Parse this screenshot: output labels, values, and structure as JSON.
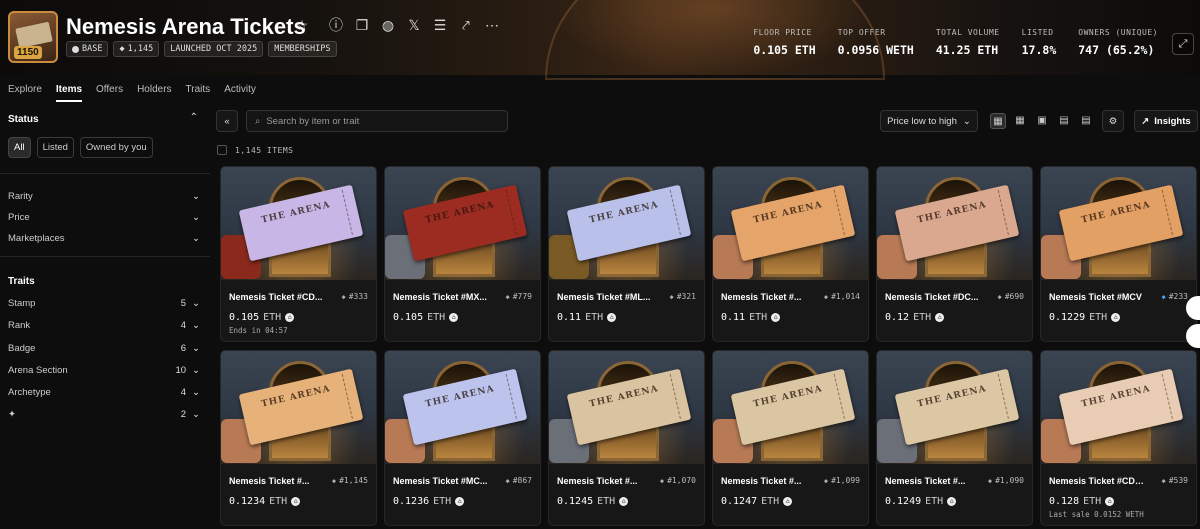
{
  "collection": {
    "title": "Nemesis Arena Tickets",
    "logo_badge": "1150",
    "chips": [
      "BASE",
      "1,145",
      "LAUNCHED OCT 2025",
      "MEMBERSHIPS"
    ],
    "header_icons": [
      "star-icon",
      "info-icon",
      "copy-icon",
      "globe-icon",
      "x-icon",
      "layers-icon",
      "share-icon",
      "more-icon"
    ]
  },
  "stats": [
    {
      "label": "FLOOR PRICE",
      "value": "0.105 ETH"
    },
    {
      "label": "TOP OFFER",
      "value": "0.0956 WETH"
    },
    {
      "label": "TOTAL VOLUME",
      "value": "41.25 ETH"
    },
    {
      "label": "LISTED",
      "value": "17.8%"
    },
    {
      "label": "OWNERS (UNIQUE)",
      "value": "747 (65.2%)"
    }
  ],
  "tabs": [
    "Explore",
    "Items",
    "Offers",
    "Holders",
    "Traits",
    "Activity"
  ],
  "sidebar": {
    "status_title": "Status",
    "status_options": [
      "All",
      "Listed",
      "Owned by you"
    ],
    "filters": [
      "Rarity",
      "Price",
      "Marketplaces"
    ],
    "traits_title": "Traits",
    "traits": [
      {
        "name": "Stamp",
        "count": "5"
      },
      {
        "name": "Rank",
        "count": "4"
      },
      {
        "name": "Badge",
        "count": "6"
      },
      {
        "name": "Arena Section",
        "count": "10"
      },
      {
        "name": "Archetype",
        "count": "4"
      },
      {
        "name": "✦",
        "count": "2"
      }
    ]
  },
  "toolbar": {
    "search_placeholder": "Search by item or trait",
    "sort": "Price low to high",
    "insights": "Insights",
    "item_count": "1,145 ITEMS"
  },
  "items": [
    {
      "name": "Nemesis Ticket #CD...",
      "rank": "#333",
      "price": "0.105",
      "unit": "ETH",
      "sub": "Ends in 04:57",
      "color": "#c7b6e6",
      "hand": "#8b2a1c",
      "rank_color": "gray"
    },
    {
      "name": "Nemesis Ticket #MX...",
      "rank": "#779",
      "price": "0.105",
      "unit": "ETH",
      "sub": "",
      "color": "#9c2b22",
      "hand": "#6b6f78",
      "rank_color": "gray"
    },
    {
      "name": "Nemesis Ticket #ML...",
      "rank": "#321",
      "price": "0.11",
      "unit": "ETH",
      "sub": "",
      "color": "#b9c0ea",
      "hand": "#7a5a24",
      "rank_color": "gray"
    },
    {
      "name": "Nemesis Ticket #...",
      "rank": "#1,014",
      "price": "0.11",
      "unit": "ETH",
      "sub": "",
      "color": "#e4a46a",
      "hand": "#b77a55",
      "rank_color": "gray"
    },
    {
      "name": "Nemesis Ticket #DC...",
      "rank": "#690",
      "price": "0.12",
      "unit": "ETH",
      "sub": "",
      "color": "#d9a88f",
      "hand": "#b77a55",
      "rank_color": "gray"
    },
    {
      "name": "Nemesis Ticket #MCV",
      "rank": "#233",
      "price": "0.1229",
      "unit": "ETH",
      "sub": "",
      "color": "#e3a064",
      "hand": "#b77a55",
      "rank_color": "blue"
    },
    {
      "name": "Nemesis Ticket #...",
      "rank": "#1,145",
      "price": "0.1234",
      "unit": "ETH",
      "sub": "",
      "color": "#e7b27a",
      "hand": "#b77a55",
      "rank_color": "gray"
    },
    {
      "name": "Nemesis Ticket #MC...",
      "rank": "#867",
      "price": "0.1236",
      "unit": "ETH",
      "sub": "",
      "color": "#bcc4ee",
      "hand": "#b77a55",
      "rank_color": "gray"
    },
    {
      "name": "Nemesis Ticket #...",
      "rank": "#1,070",
      "price": "0.1245",
      "unit": "ETH",
      "sub": "",
      "color": "#d9c3a0",
      "hand": "#6b6f78",
      "rank_color": "gray"
    },
    {
      "name": "Nemesis Ticket #...",
      "rank": "#1,099",
      "price": "0.1247",
      "unit": "ETH",
      "sub": "",
      "color": "#dbc6a4",
      "hand": "#b77a55",
      "rank_color": "gray"
    },
    {
      "name": "Nemesis Ticket #...",
      "rank": "#1,090",
      "price": "0.1249",
      "unit": "ETH",
      "sub": "",
      "color": "#dcc7a5",
      "hand": "#6b6f78",
      "rank_color": "gray"
    },
    {
      "name": "Nemesis Ticket #CDLII",
      "rank": "#539",
      "price": "0.128",
      "unit": "ETH",
      "sub": "Last sale 0.0152 WETH",
      "color": "#e8cdb4",
      "hand": "#b77a55",
      "rank_color": "gray"
    }
  ]
}
